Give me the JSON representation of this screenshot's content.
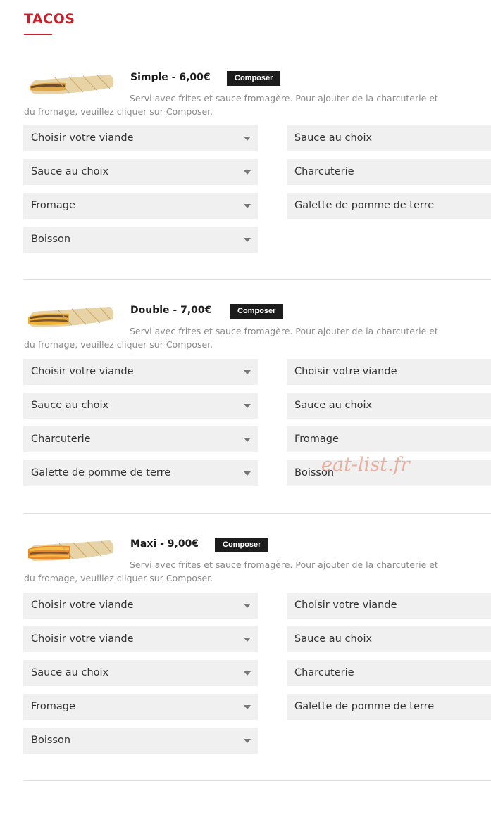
{
  "section": {
    "title": "TACOS"
  },
  "composer_label": "Composer",
  "description": "Servi avec frites et sauce fromagère. Pour ajouter de la charcuterie et du fromage, veuillez cliquer sur Composer.",
  "items": [
    {
      "name": "Simple - 6,00€",
      "left_selects": [
        "Choisir votre viande",
        "Sauce au choix",
        "Fromage",
        "Boisson"
      ],
      "right_selects": [
        "Sauce au choix",
        "Charcuterie",
        "Galette de pomme de terre"
      ]
    },
    {
      "name": "Double - 7,00€",
      "left_selects": [
        "Choisir votre viande",
        "Sauce au choix",
        "Charcuterie",
        "Galette de pomme de terre"
      ],
      "right_selects": [
        "Choisir votre viande",
        "Sauce au choix",
        "Fromage",
        "Boisson"
      ]
    },
    {
      "name": "Maxi - 9,00€",
      "left_selects": [
        "Choisir votre viande",
        "Choisir votre viande",
        "Sauce au choix",
        "Fromage",
        "Boisson"
      ],
      "right_selects": [
        "Choisir votre viande",
        "Sauce au choix",
        "Charcuterie",
        "Galette de pomme de terre"
      ]
    }
  ],
  "watermark": "eat-list.fr",
  "colors": {
    "accent": "#c8202b",
    "button_bg": "#1c1c1c",
    "select_bg": "#f0f0f0"
  },
  "icons": {
    "select_caret": "caret-down-icon"
  }
}
